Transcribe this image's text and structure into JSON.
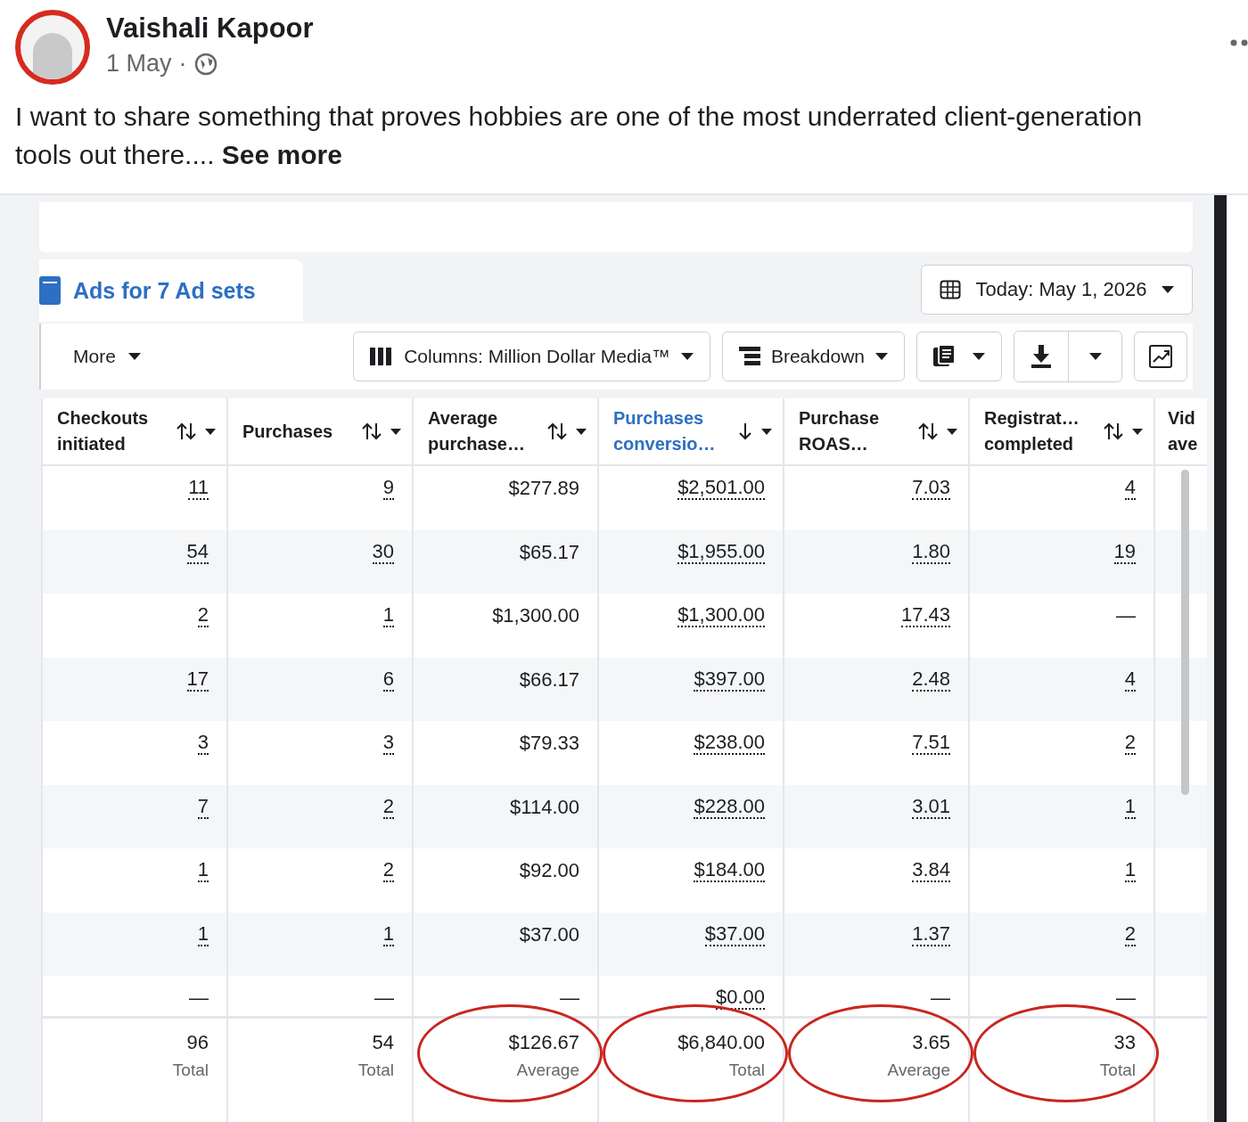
{
  "post": {
    "author": "Vaishali Kapoor",
    "date": "1 May",
    "separator": "·",
    "text": "I want to share something that proves hobbies are one of the most underrated client-generation tools out there....",
    "see_more": "See more"
  },
  "ads": {
    "tab_label": "Ads for 7 Ad sets",
    "date_button": "Today: May 1, 2026",
    "more_button": "More",
    "columns_button": "Columns: Million Dollar Media™",
    "breakdown_button": "Breakdown",
    "columns": [
      {
        "label": "Checkouts initiated",
        "selected": false,
        "linked": true
      },
      {
        "label": "Purchases",
        "selected": false,
        "linked": true
      },
      {
        "label": "Average purchase…",
        "selected": false,
        "linked": false
      },
      {
        "label": "Purchases conversio…",
        "selected": true,
        "linked": true
      },
      {
        "label": "Purchase ROAS…",
        "selected": false,
        "linked": true
      },
      {
        "label": "Registrat… completed",
        "selected": false,
        "linked": true
      },
      {
        "label": "Vid ave",
        "selected": false
      }
    ],
    "rows": [
      [
        "11",
        "9",
        "$277.89",
        "$2,501.00",
        "7.03",
        "4"
      ],
      [
        "54",
        "30",
        "$65.17",
        "$1,955.00",
        "1.80",
        "19"
      ],
      [
        "2",
        "1",
        "$1,300.00",
        "$1,300.00",
        "17.43",
        "—"
      ],
      [
        "17",
        "6",
        "$66.17",
        "$397.00",
        "2.48",
        "4"
      ],
      [
        "3",
        "3",
        "$79.33",
        "$238.00",
        "7.51",
        "2"
      ],
      [
        "7",
        "2",
        "$114.00",
        "$228.00",
        "3.01",
        "1"
      ],
      [
        "1",
        "2",
        "$92.00",
        "$184.00",
        "3.84",
        "1"
      ],
      [
        "1",
        "1",
        "$37.00",
        "$37.00",
        "1.37",
        "2"
      ],
      [
        "—",
        "—",
        "—",
        "$0.00",
        "—",
        "—"
      ]
    ],
    "totals": [
      {
        "value": "96",
        "label": "Total",
        "circled": false
      },
      {
        "value": "54",
        "label": "Total",
        "circled": false
      },
      {
        "value": "$126.67",
        "label": "Average",
        "circled": true
      },
      {
        "value": "$6,840.00",
        "label": "Total",
        "circled": true
      },
      {
        "value": "3.65",
        "label": "Average",
        "circled": true
      },
      {
        "value": "33",
        "label": "Total",
        "circled": true
      }
    ]
  }
}
